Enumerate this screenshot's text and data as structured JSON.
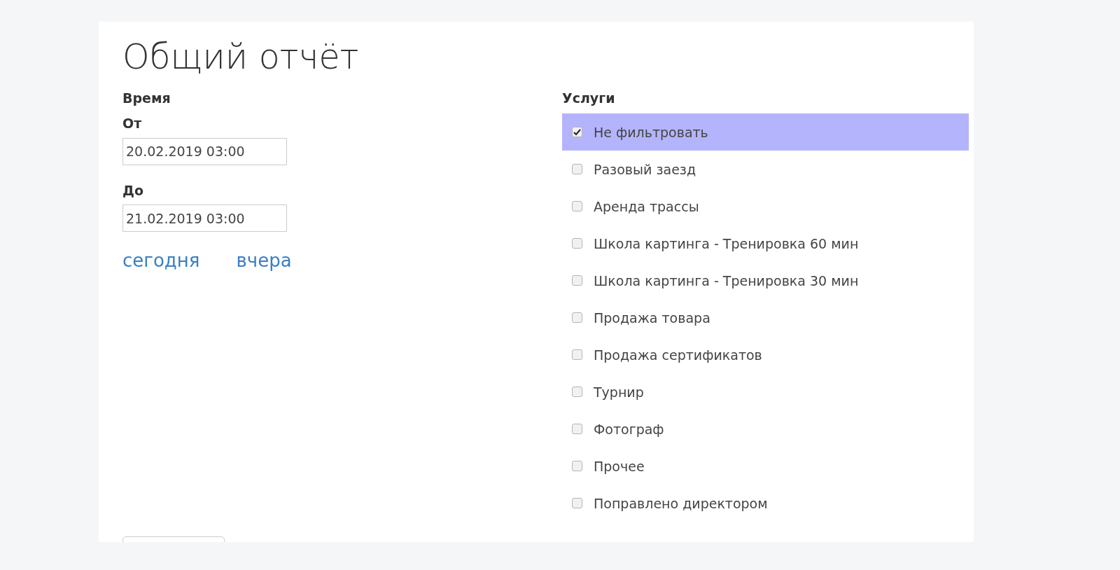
{
  "title": "Общий отчёт",
  "time": {
    "heading": "Время",
    "from": {
      "label": "От",
      "value": "20.02.2019 03:00"
    },
    "to": {
      "label": "До",
      "value": "21.02.2019 03:00"
    },
    "links": [
      "сегодня",
      "вчера"
    ]
  },
  "services": {
    "heading": "Услуги",
    "items": [
      {
        "label": "Не фильтровать",
        "checked": true
      },
      {
        "label": "Разовый заезд",
        "checked": false
      },
      {
        "label": "Аренда трассы",
        "checked": false
      },
      {
        "label": "Школа картинга - Тренировка 60 мин",
        "checked": false
      },
      {
        "label": "Школа картинга - Тренировка 30 мин",
        "checked": false
      },
      {
        "label": "Продажа товара",
        "checked": false
      },
      {
        "label": "Продажа сертификатов",
        "checked": false
      },
      {
        "label": "Турнир",
        "checked": false
      },
      {
        "label": "Фотограф",
        "checked": false
      },
      {
        "label": "Прочее",
        "checked": false
      },
      {
        "label": "Поправлено директором",
        "checked": false
      }
    ]
  }
}
